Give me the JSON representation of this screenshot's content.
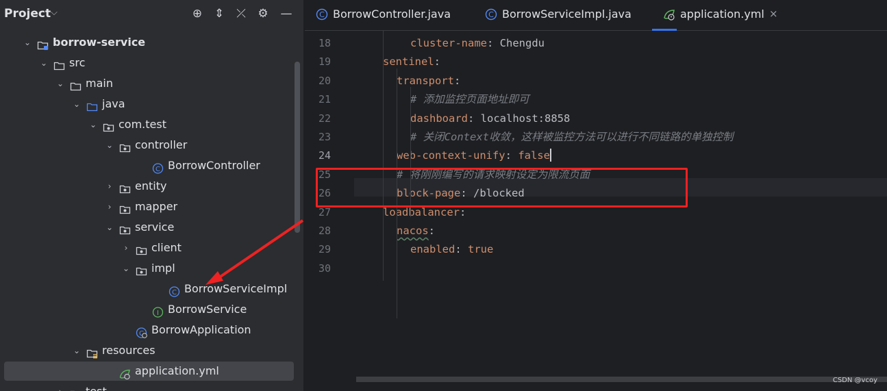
{
  "project_panel": {
    "title": "Project",
    "title_chevron": "⌵",
    "tools": [
      {
        "name": "locate-icon",
        "glyph": "⊕"
      },
      {
        "name": "expand-collapse-icon",
        "glyph": "⇕"
      },
      {
        "name": "collapse-all-icon",
        "glyph": "⤫"
      },
      {
        "name": "gear-icon",
        "glyph": "⚙"
      },
      {
        "name": "minimize-icon",
        "glyph": "—"
      }
    ],
    "tree": [
      {
        "label": "borrow-service",
        "chevron": "⌄",
        "icon": "module-folder-icon",
        "bold": true
      },
      {
        "label": "src",
        "chevron": "⌄",
        "icon": "folder-icon"
      },
      {
        "label": "main",
        "chevron": "⌄",
        "icon": "folder-icon"
      },
      {
        "label": "java",
        "chevron": "⌄",
        "icon": "source-folder-icon"
      },
      {
        "label": "com.test",
        "chevron": "⌄",
        "icon": "package-icon"
      },
      {
        "label": "controller",
        "chevron": "⌄",
        "icon": "package-icon"
      },
      {
        "label": "BorrowController",
        "chevron": "",
        "icon": "class-icon"
      },
      {
        "label": "entity",
        "chevron": "›",
        "icon": "package-icon"
      },
      {
        "label": "mapper",
        "chevron": "›",
        "icon": "package-icon"
      },
      {
        "label": "service",
        "chevron": "⌄",
        "icon": "package-icon"
      },
      {
        "label": "client",
        "chevron": "›",
        "icon": "package-icon"
      },
      {
        "label": "impl",
        "chevron": "⌄",
        "icon": "package-icon"
      },
      {
        "label": "BorrowServiceImpl",
        "chevron": "",
        "icon": "class-icon"
      },
      {
        "label": "BorrowService",
        "chevron": "",
        "icon": "interface-icon"
      },
      {
        "label": "BorrowApplication",
        "chevron": "",
        "icon": "spring-boot-class-icon"
      },
      {
        "label": "resources",
        "chevron": "⌄",
        "icon": "resources-folder-icon"
      },
      {
        "label": "application.yml",
        "chevron": "",
        "icon": "yaml-spring-icon",
        "selected": true
      },
      {
        "label": "test",
        "chevron": "›",
        "icon": "folder-icon"
      }
    ]
  },
  "editor": {
    "tabs": [
      {
        "label": "BorrowController.java",
        "icon": "class-icon"
      },
      {
        "label": "BorrowServiceImpl.java",
        "icon": "class-icon"
      },
      {
        "label": "application.yml",
        "icon": "yaml-spring-icon",
        "active": true,
        "close": "×"
      }
    ],
    "current_line": 24,
    "lines": [
      {
        "n": "18",
        "indent": 4,
        "parts": [
          {
            "t": "cluster-name",
            "s": "k"
          },
          {
            "t": ": ",
            "s": "p"
          },
          {
            "t": "Chengdu",
            "s": "v"
          }
        ]
      },
      {
        "n": "19",
        "indent": 0,
        "parts": [
          {
            "t": "sentinel",
            "s": "k"
          },
          {
            "t": ":",
            "s": "p"
          }
        ]
      },
      {
        "n": "20",
        "indent": 2,
        "parts": [
          {
            "t": "transport",
            "s": "k"
          },
          {
            "t": ":",
            "s": "p"
          }
        ]
      },
      {
        "n": "21",
        "indent": 4,
        "parts": [
          {
            "t": "# 添加监控页面地址即可",
            "s": "c"
          }
        ]
      },
      {
        "n": "22",
        "indent": 4,
        "parts": [
          {
            "t": "dashboard",
            "s": "k"
          },
          {
            "t": ": ",
            "s": "p"
          },
          {
            "t": "localhost:8858",
            "s": "v"
          }
        ]
      },
      {
        "n": "23",
        "indent": 4,
        "parts": [
          {
            "t": "# 关闭Context收敛，这样被监控方法可以进行不同链路的单独控制",
            "s": "c"
          }
        ]
      },
      {
        "n": "24",
        "indent": 2,
        "parts": [
          {
            "t": "web-context-unify",
            "s": "k"
          },
          {
            "t": ": ",
            "s": "p"
          },
          {
            "t": "false",
            "s": "kw"
          }
        ],
        "caret": true
      },
      {
        "n": "25",
        "indent": 2,
        "parts": [
          {
            "t": "# 将刚刚编写的请求映射设定为限流页面",
            "s": "c"
          }
        ]
      },
      {
        "n": "26",
        "indent": 2,
        "parts": [
          {
            "t": "block-page",
            "s": "k"
          },
          {
            "t": ": ",
            "s": "p"
          },
          {
            "t": "/blocked",
            "s": "v"
          }
        ]
      },
      {
        "n": "27",
        "indent": 0,
        "parts": [
          {
            "t": "loadbalancer",
            "s": "k"
          },
          {
            "t": ":",
            "s": "p"
          }
        ]
      },
      {
        "n": "28",
        "indent": 2,
        "parts": [
          {
            "t": "nacos",
            "s": "k squiggle"
          },
          {
            "t": ":",
            "s": "p"
          }
        ]
      },
      {
        "n": "29",
        "indent": 4,
        "parts": [
          {
            "t": "enabled",
            "s": "k"
          },
          {
            "t": ": ",
            "s": "p"
          },
          {
            "t": "true",
            "s": "kw"
          }
        ]
      },
      {
        "n": "30",
        "indent": 0,
        "parts": []
      }
    ]
  },
  "watermark": "CSDN @vcoy",
  "colors": {
    "annotation_red": "#ee2222",
    "accent_blue": "#3574f0",
    "yaml_key": "#cf8e6d",
    "comment": "#7a7e85"
  }
}
